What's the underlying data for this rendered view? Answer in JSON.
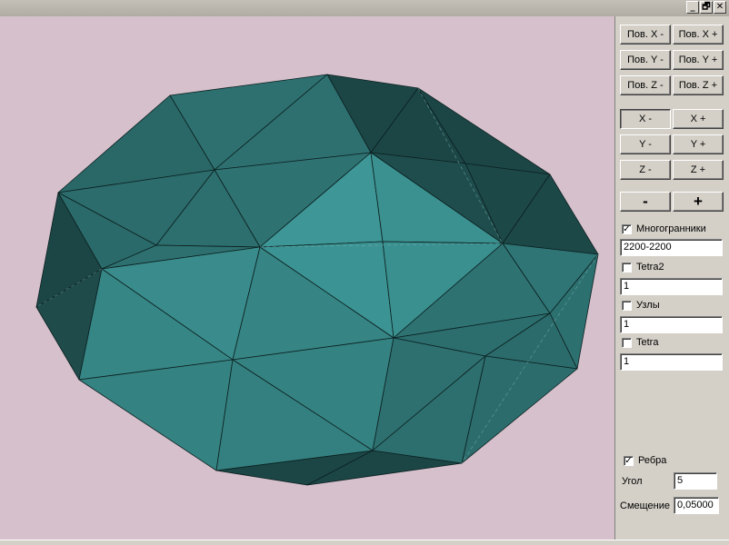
{
  "window": {
    "buttons": [
      "_",
      "🗗",
      "✕"
    ]
  },
  "controls": {
    "pos_x_minus": "Пов. X -",
    "pos_x_plus": "Пов. X +",
    "pos_y_minus": "Пов. Y -",
    "pos_y_plus": "Пов. Y +",
    "pos_z_minus": "Пов. Z -",
    "pos_z_plus": "Пов. Z +",
    "x_minus": "X -",
    "x_plus": "X +",
    "y_minus": "Y -",
    "y_plus": "Y +",
    "z_minus": "Z -",
    "z_plus": "Z +",
    "zoom_minus": "-",
    "zoom_plus": "+"
  },
  "options": {
    "polyhedra": {
      "label": "Многогранники",
      "checked": true,
      "value": "2200-2200"
    },
    "tetra2": {
      "label": "Tetra2",
      "checked": false,
      "value": "1"
    },
    "nodes": {
      "label": "Узлы",
      "checked": false,
      "value": "1"
    },
    "tetra": {
      "label": "Tetra",
      "checked": false,
      "value": "1"
    }
  },
  "edges": {
    "label": "Ребра",
    "checked": true
  },
  "angle": {
    "label": "Угол",
    "value": "5"
  },
  "offset": {
    "label": "Смещение",
    "value": "0,05000"
  },
  "colors": {
    "viewport_bg": "#d5c0cb",
    "face_light": "#3e9696",
    "face_mid": "#2f7878",
    "face_dark": "#265f5f",
    "face_darkest": "#1c4646"
  }
}
